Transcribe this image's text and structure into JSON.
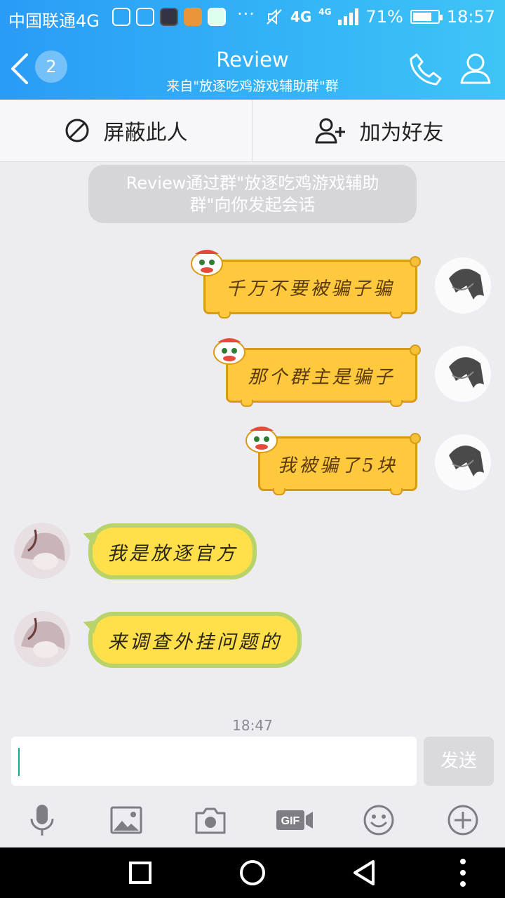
{
  "status_bar": {
    "carrier": "中国联通4G",
    "network_primary": "4G",
    "network_secondary": "4G",
    "battery": "71%",
    "battery_level": 0.71,
    "time": "18:57",
    "overflow": "···"
  },
  "header": {
    "unread_count": "2",
    "title": "Review",
    "subtitle": "来自\"放逐吃鸡游戏辅助群\"群",
    "call_icon": "phone-icon",
    "profile_icon": "person-icon"
  },
  "actions": {
    "block_label": "屏蔽此人",
    "add_friend_label": "加为好友"
  },
  "notice": {
    "line1": "Review通过群\"放逐吃鸡游戏辅助",
    "line2": "群\"向你发起会话"
  },
  "messages": {
    "out1": "千万不要被骗子骗",
    "out2": "那个群主是骗子",
    "out3": "我被骗了5块",
    "in1": "我是放逐官方",
    "in2": "来调查外挂问题的"
  },
  "timestamp": "18:47",
  "composer": {
    "input_value": "",
    "send_label": "发送"
  },
  "toolbar_icons": [
    "microphone-icon",
    "image-icon",
    "camera-icon",
    "gif-icon",
    "emoji-icon",
    "plus-icon"
  ],
  "colors": {
    "header_start": "#2a9bf6",
    "header_end": "#3fc4f6",
    "outgoing_bubble": "#ffc93d",
    "incoming_bubble": "#ffe04a",
    "incoming_border": "#b7d36a"
  }
}
